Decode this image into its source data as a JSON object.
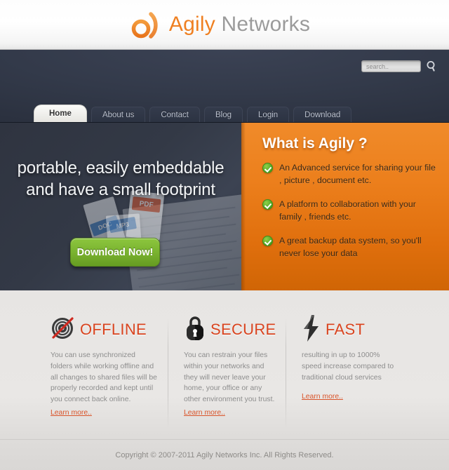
{
  "colors": {
    "brand_orange": "#ef8022",
    "nav_dark": "#2e3442",
    "panel_orange": "#e6780f",
    "green_button": "#79b22f",
    "feature_red": "#d9441f",
    "link_red": "#d9542a"
  },
  "header": {
    "logo_icon": "agily-circle-arc-logo",
    "logo_text_accent": "Agily",
    "logo_text_rest": " Networks"
  },
  "search": {
    "placeholder": "search..",
    "value": "",
    "icon": "search-icon"
  },
  "nav": {
    "items": [
      {
        "label": "Home",
        "active": true
      },
      {
        "label": "About us",
        "active": false
      },
      {
        "label": "Contact",
        "active": false
      },
      {
        "label": "Blog",
        "active": false
      },
      {
        "label": "Login",
        "active": false
      },
      {
        "label": "Download",
        "active": false
      }
    ]
  },
  "hero": {
    "headline_line1": "portable, easily embeddable",
    "headline_line2": "and have a small footprint",
    "cta_label": "Download Now!",
    "artwork": {
      "doc_tag": "DOC",
      "pdf_tag": "PDF",
      "mp3_tag": "MP3"
    }
  },
  "panel": {
    "title": "What is Agily ?",
    "bullets": [
      {
        "icon": "check-circle-icon",
        "text": "An Advanced service for sharing your file , picture , document etc."
      },
      {
        "icon": "check-circle-icon",
        "text": "A platform to collaboration with your family , friends etc."
      },
      {
        "icon": "check-circle-icon",
        "text": "A great backup data system, so you'll never lose your data"
      }
    ]
  },
  "features": [
    {
      "icon": "wifi-offline-icon",
      "title": "OFFLINE",
      "body": "You can use synchronized folders while working offline and all changes to shared files  will be properly recorded and kept until you connect back online.",
      "link": "Learn more.."
    },
    {
      "icon": "padlock-icon",
      "title": "SECURE",
      "body": "You can restrain your files  within your networks and they will never leave your home, your office or any other environment you trust.",
      "link": "Learn more.."
    },
    {
      "icon": "lightning-bolt-icon",
      "title": "FAST",
      "body": "resulting in up to 1000% speed increase compared to traditional cloud services",
      "link": "Learn more.."
    }
  ],
  "footer": {
    "copyright": "Copyright © 2007-2011 Agily Networks Inc. All Rights Reserved."
  }
}
